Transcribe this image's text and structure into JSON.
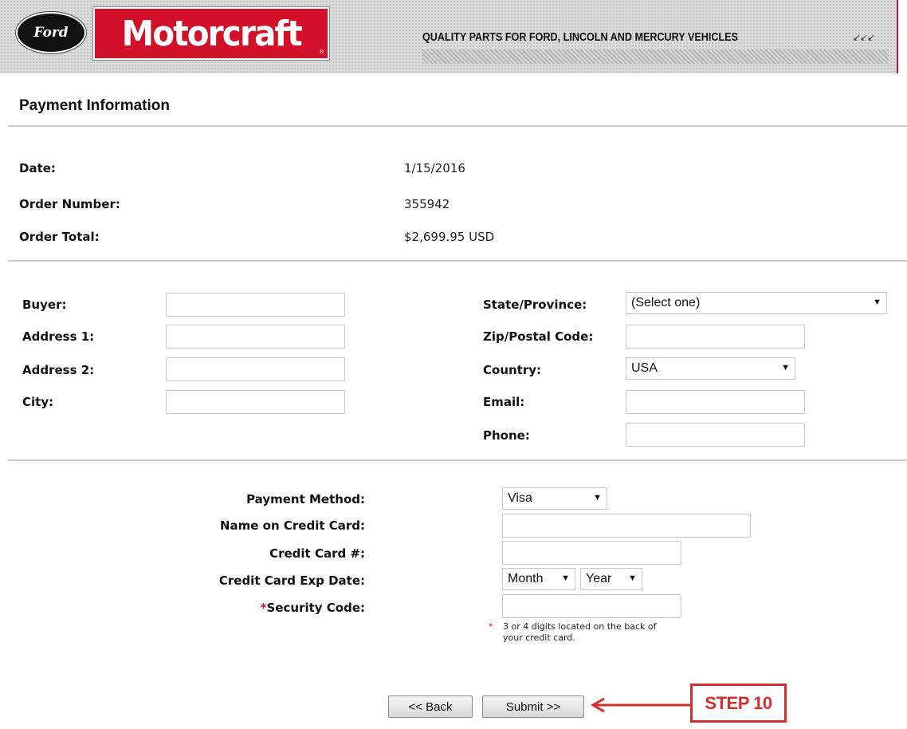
{
  "header": {
    "ford_logo_text": "Ford",
    "brand_logo_text": "Motorcraft",
    "tagline": "QUALITY PARTS FOR FORD, LINCOLN AND MERCURY VEHICLES",
    "chevrons": "↙↙↙"
  },
  "page_title": "Payment Information",
  "summary": {
    "date_label": "Date:",
    "date_value": "1/15/2016",
    "order_number_label": "Order Number:",
    "order_number_value": "355942",
    "order_total_label": "Order Total:",
    "order_total_value": "$2,699.95 USD"
  },
  "buyer": {
    "buyer_label": "Buyer:",
    "buyer_value": "",
    "address1_label": "Address 1:",
    "address1_value": "",
    "address2_label": "Address 2:",
    "address2_value": "",
    "city_label": "City:",
    "city_value": "",
    "state_label": "State/Province:",
    "state_selected": "(Select one)",
    "zip_label": "Zip/Postal Code:",
    "zip_value": "",
    "country_label": "Country:",
    "country_selected": "USA",
    "email_label": "Email:",
    "email_value": "",
    "phone_label": "Phone:",
    "phone_value": ""
  },
  "payment": {
    "method_label": "Payment Method:",
    "method_selected": "Visa",
    "name_label": "Name on Credit Card:",
    "name_value": "",
    "card_label": "Credit Card #:",
    "card_value": "",
    "exp_label": "Credit Card Exp Date:",
    "exp_month_selected": "Month",
    "exp_year_selected": "Year",
    "security_required_mark": "*",
    "security_label": "Security Code:",
    "security_value": "",
    "security_hint_mark": "*",
    "security_hint": "3 or 4 digits located on the back of your credit card."
  },
  "buttons": {
    "back_label": "<< Back",
    "submit_label": "Submit >>"
  },
  "annotation": {
    "step_label": "STEP 10",
    "color": "#d32f2f"
  },
  "colors": {
    "brand_red": "#d3102a",
    "divider": "#c9c9c9"
  },
  "icons": {
    "dropdown": "dropdown-arrow-icon"
  }
}
